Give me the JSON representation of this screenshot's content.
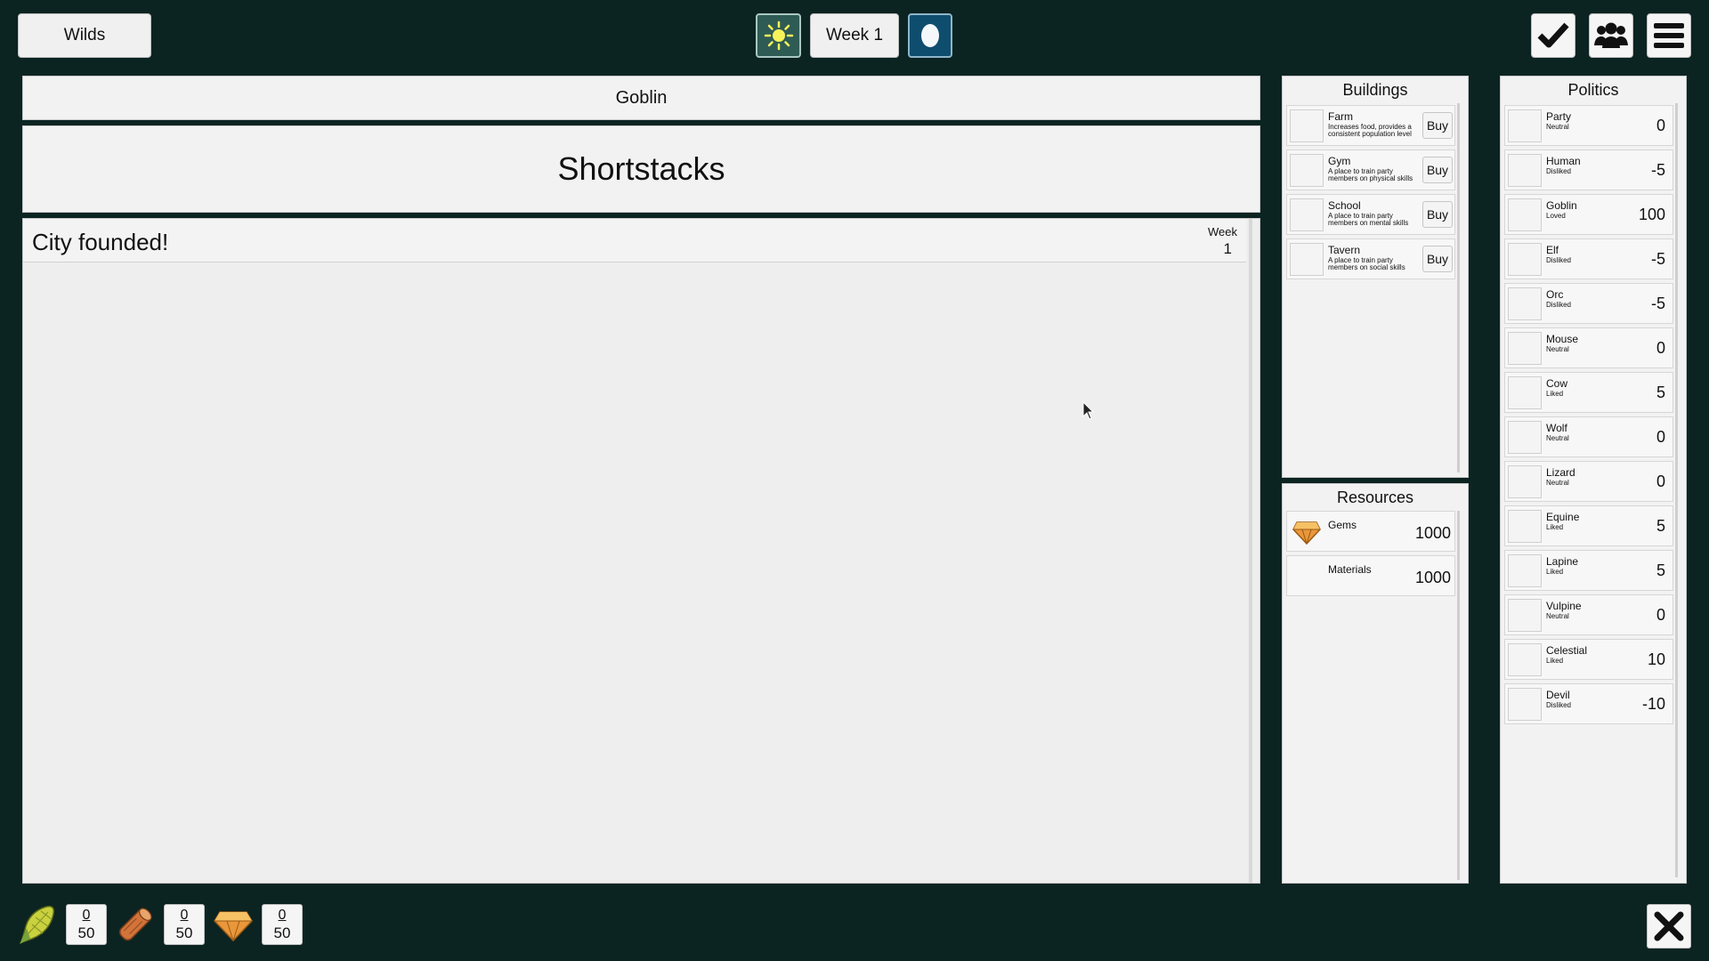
{
  "topbar": {
    "location_label": "Wilds",
    "week_label": "Week 1",
    "sun_icon": "sun-icon",
    "moon_icon": "moon-icon",
    "right_icons": [
      "check-icon",
      "group-icon",
      "menu-icon"
    ]
  },
  "main": {
    "race_header": "Goblin",
    "city_title": "Shortstacks",
    "log": [
      {
        "text": "City founded!",
        "week_label": "Week",
        "week": "1"
      }
    ]
  },
  "buildings": {
    "title": "Buildings",
    "items": [
      {
        "name": "Farm",
        "desc": "Increases food, provides a consistent population level",
        "buy": "Buy"
      },
      {
        "name": "Gym",
        "desc": "A place to train party members on physical skills",
        "buy": "Buy"
      },
      {
        "name": "School",
        "desc": "A place to train party members on mental skills",
        "buy": "Buy"
      },
      {
        "name": "Tavern",
        "desc": "A place to train party members on social skills",
        "buy": "Buy"
      }
    ]
  },
  "resources": {
    "title": "Resources",
    "items": [
      {
        "name": "Gems",
        "value": "1000",
        "icon": "gem-icon"
      },
      {
        "name": "Materials",
        "value": "1000",
        "icon": ""
      }
    ]
  },
  "politics": {
    "title": "Politics",
    "items": [
      {
        "name": "Party",
        "stance": "Neutral",
        "value": "0"
      },
      {
        "name": "Human",
        "stance": "Disliked",
        "value": "-5"
      },
      {
        "name": "Goblin",
        "stance": "Loved",
        "value": "100"
      },
      {
        "name": "Elf",
        "stance": "Disliked",
        "value": "-5"
      },
      {
        "name": "Orc",
        "stance": "Disliked",
        "value": "-5"
      },
      {
        "name": "Mouse",
        "stance": "Neutral",
        "value": "0"
      },
      {
        "name": "Cow",
        "stance": "Liked",
        "value": "5"
      },
      {
        "name": "Wolf",
        "stance": "Neutral",
        "value": "0"
      },
      {
        "name": "Lizard",
        "stance": "Neutral",
        "value": "0"
      },
      {
        "name": "Equine",
        "stance": "Liked",
        "value": "5"
      },
      {
        "name": "Lapine",
        "stance": "Liked",
        "value": "5"
      },
      {
        "name": "Vulpine",
        "stance": "Neutral",
        "value": "0"
      },
      {
        "name": "Celestial",
        "stance": "Liked",
        "value": "10"
      },
      {
        "name": "Devil",
        "stance": "Disliked",
        "value": "-10"
      }
    ]
  },
  "bottombar": {
    "resources": [
      {
        "icon": "corn-icon",
        "current": "0",
        "max": "50"
      },
      {
        "icon": "wood-log-icon",
        "current": "0",
        "max": "50"
      },
      {
        "icon": "gem-icon",
        "current": "0",
        "max": "50"
      }
    ],
    "close_icon": "close-icon"
  },
  "colors": {
    "background": "#0b2422",
    "panel": "#f2f2f2",
    "sun_button": "#2f5b55",
    "moon_button": "#0f4d6e",
    "sun_yellow": "#f6f25a",
    "gem_orange": "#e9973a"
  }
}
